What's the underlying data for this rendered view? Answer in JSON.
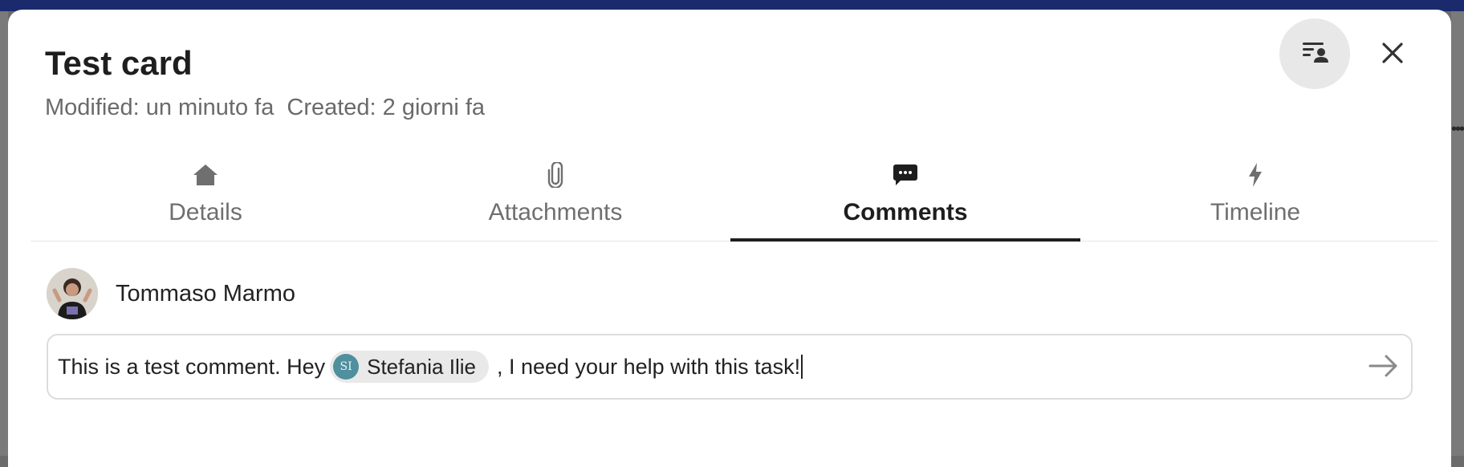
{
  "card": {
    "title": "Test card",
    "modified": "Modified: un minuto fa",
    "created": "Created: 2 giorni fa"
  },
  "header_actions": {
    "sidebar_toggle_icon": "sidebar-toggle-icon",
    "close_icon": "close-icon"
  },
  "tabs": [
    {
      "label": "Details",
      "icon": "home-icon",
      "active": false
    },
    {
      "label": "Attachments",
      "icon": "paperclip-icon",
      "active": false
    },
    {
      "label": "Comments",
      "icon": "comment-icon",
      "active": true
    },
    {
      "label": "Timeline",
      "icon": "lightning-icon",
      "active": false
    }
  ],
  "comment_composer": {
    "author_name": "Tommaso Marmo",
    "text_before_mention": "This is a test comment. Hey",
    "mention": {
      "initials": "SI",
      "name": "Stefania Ilie"
    },
    "text_after_mention": ", I need your help with this task!",
    "send_icon": "arrow-right-icon"
  },
  "colors": {
    "accent_dark": "#1e1e1e",
    "muted_text": "#6a6a6a",
    "mention_avatar": "#4f8f9e",
    "topbar": "#1a2a6c"
  }
}
